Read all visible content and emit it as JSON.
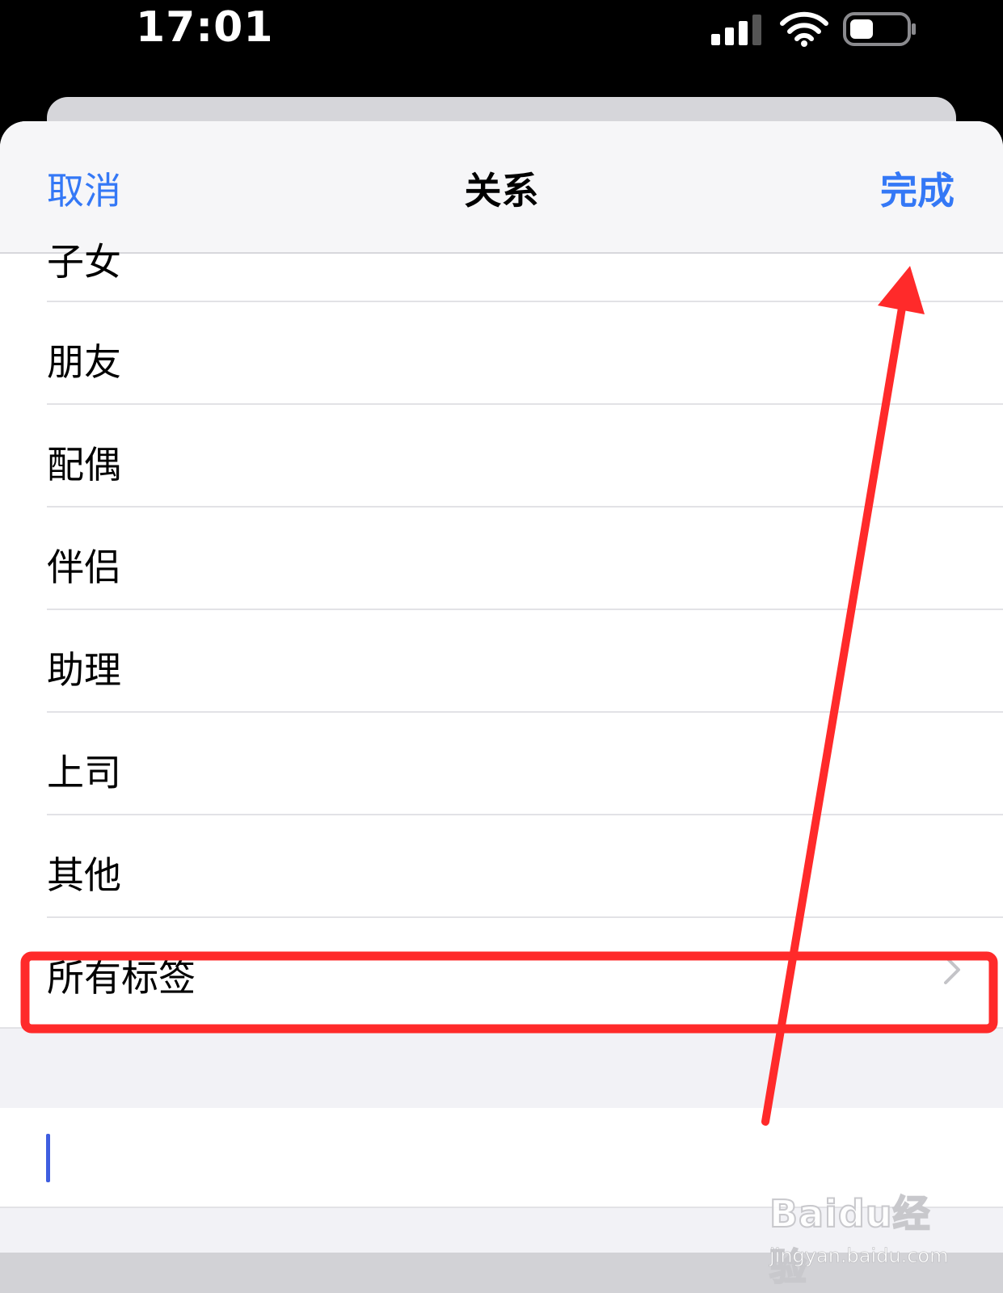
{
  "status_bar": {
    "time": "17:01",
    "icons": [
      "cellular-signal-icon",
      "wifi-icon",
      "battery-icon"
    ]
  },
  "nav": {
    "cancel_label": "取消",
    "title": "关系",
    "done_label": "完成"
  },
  "list": {
    "items": [
      {
        "label": "子女",
        "partial": true
      },
      {
        "label": "朋友"
      },
      {
        "label": "配偶"
      },
      {
        "label": "伴侣"
      },
      {
        "label": "助理"
      },
      {
        "label": "上司"
      },
      {
        "label": "其他"
      },
      {
        "label": "所有标签",
        "has_chevron": true
      }
    ]
  },
  "custom_input": {
    "value": ""
  },
  "watermark": {
    "logo": "Baidu经验",
    "url": "jingyan.baidu.com"
  },
  "colors": {
    "accent": "#3478f6",
    "annotation": "#ff2a2a",
    "cursor": "#3f5ee0"
  }
}
